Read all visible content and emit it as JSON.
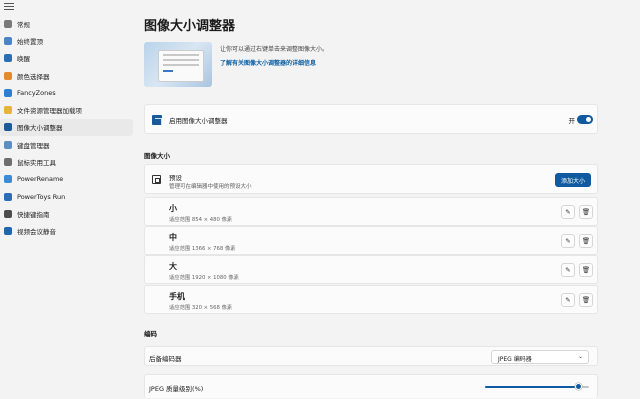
{
  "sidebar": {
    "items": [
      {
        "label": "常规",
        "icon": "home-gear-icon",
        "color": "#7a7a7a"
      },
      {
        "label": "始终置顶",
        "icon": "pin-icon",
        "color": "#4a84c6"
      },
      {
        "label": "唤醒",
        "icon": "coffee-cup-icon",
        "color": "#2b6fb3"
      },
      {
        "label": "颜色选择器",
        "icon": "color-picker-icon",
        "color": "#e58a2b"
      },
      {
        "label": "FancyZones",
        "icon": "fancyzones-icon",
        "color": "#2f7fd0"
      },
      {
        "label": "文件资源管理器加载项",
        "icon": "folder-icon",
        "color": "#e8b33a"
      },
      {
        "label": "图像大小调整器",
        "icon": "image-resizer-icon",
        "color": "#1b5a99",
        "active": true
      },
      {
        "label": "键盘管理器",
        "icon": "keyboard-icon",
        "color": "#5e8fc4"
      },
      {
        "label": "鼠标实用工具",
        "icon": "mouse-icon",
        "color": "#6f6f6f"
      },
      {
        "label": "PowerRename",
        "icon": "rename-icon",
        "color": "#3d8bd4"
      },
      {
        "label": "PowerToys Run",
        "icon": "run-icon",
        "color": "#2c6db6"
      },
      {
        "label": "快捷键指南",
        "icon": "shortcut-guide-icon",
        "color": "#4d4d4d"
      },
      {
        "label": "视频会议静音",
        "icon": "camera-icon",
        "color": "#1f66ad"
      }
    ]
  },
  "main": {
    "title": "图像大小调整器",
    "hero_desc": "让你可以通过右键单击来调整图像大小。",
    "hero_link": "了解有关图像大小调整器的详细信息",
    "enable": {
      "label": "启用图像大小调整器",
      "state_text": "开",
      "on": true
    },
    "sizes_section": "图像大小",
    "presets": {
      "title": "预设",
      "subtitle": "管理可在编辑器中使用的预设大小",
      "add_button": "添加大小"
    },
    "sizes": [
      {
        "name": "小",
        "dims": "适应范围 854 × 480 像素"
      },
      {
        "name": "中",
        "dims": "适应范围 1366 × 768 像素"
      },
      {
        "name": "大",
        "dims": "适应范围 1920 × 1080 像素"
      },
      {
        "name": "手机",
        "dims": "适应范围 320 × 568 像素"
      }
    ],
    "encoding_section": "编码",
    "encoder": {
      "label": "后备编码器",
      "value": "JPEG 编码器"
    },
    "quality": {
      "label": "JPEG 质量级别(%)",
      "value": 90
    }
  },
  "colors": {
    "accent": "#0f5aa0"
  }
}
